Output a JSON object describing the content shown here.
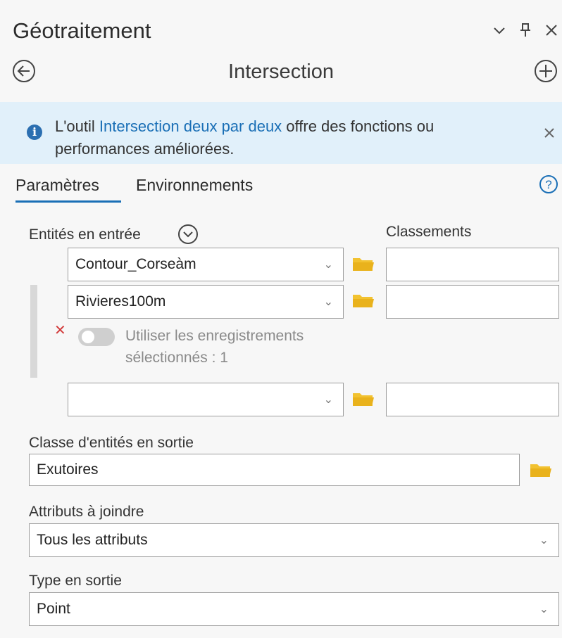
{
  "header": {
    "title": "Géotraitement",
    "tool_name": "Intersection"
  },
  "banner": {
    "text_before": "L'outil ",
    "link": "Intersection deux par deux",
    "text_after": " offre des fonctions ou performances améliorées."
  },
  "tabs": [
    {
      "label": "Paramètres",
      "active": true
    },
    {
      "label": "Environnements",
      "active": false
    }
  ],
  "inputs": {
    "label": "Entités en entrée",
    "ranks_label": "Classements",
    "rows": [
      {
        "value": "Contour_Corseàm",
        "rank": ""
      },
      {
        "value": "Rivieres100m",
        "rank": ""
      },
      {
        "value": "",
        "rank": ""
      }
    ],
    "selected_toggle": {
      "label": "Utiliser les enregistrements sélectionnés : 1",
      "on": false
    }
  },
  "output": {
    "label": "Classe d'entités en sortie",
    "value": "Exutoires"
  },
  "join_attributes": {
    "label": "Attributs à joindre",
    "value": "Tous les attributs"
  },
  "output_type": {
    "label": "Type en sortie",
    "value": "Point"
  },
  "icons": {
    "minimize": "chevron-down-icon",
    "pin": "pin-icon",
    "close": "close-icon",
    "back": "back-arrow-icon",
    "add": "plus-circle-icon",
    "info": "info-icon",
    "help": "help-icon",
    "browse": "folder-icon"
  },
  "colors": {
    "accent": "#1a6fb6",
    "banner_bg": "#e1f0fa",
    "folder": "#f2c230",
    "remove": "#d23a3a"
  }
}
